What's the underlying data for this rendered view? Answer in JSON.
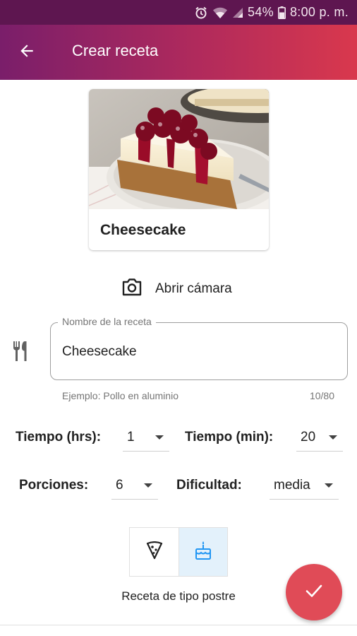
{
  "status_bar": {
    "battery": "54%",
    "time": "8:00 p. m.",
    "icons": [
      "alarm-icon",
      "wifi-icon",
      "signal-icon",
      "battery-icon"
    ]
  },
  "app_bar": {
    "title": "Crear receta",
    "back_icon": "arrow-back-icon",
    "gradient_colors": [
      "#7a1e6a",
      "#b02a5c",
      "#d9384d"
    ]
  },
  "recipe_card": {
    "title": "Cheesecake",
    "image": "cheesecake-photo"
  },
  "camera": {
    "label": "Abrir cámara",
    "icon": "camera-icon"
  },
  "name_field": {
    "label": "Nombre de la receta",
    "value": "Cheesecake",
    "helper": "Ejemplo: Pollo en aluminio",
    "counter": "10/80",
    "icon": "utensils-icon"
  },
  "time_hours": {
    "label": "Tiempo (hrs):",
    "value": "1"
  },
  "time_minutes": {
    "label": "Tiempo (min):",
    "value": "20"
  },
  "portions": {
    "label": "Porciones:",
    "value": "6"
  },
  "difficulty": {
    "label": "Dificultad:",
    "value": "media"
  },
  "recipe_type": {
    "options": [
      {
        "icon": "pizza-slice-icon",
        "selected": false
      },
      {
        "icon": "cake-icon",
        "selected": true
      }
    ],
    "caption": "Receta de tipo postre",
    "selected_color": "#e3f1fb"
  },
  "fab": {
    "icon": "check-icon",
    "color": "#e04b57"
  }
}
